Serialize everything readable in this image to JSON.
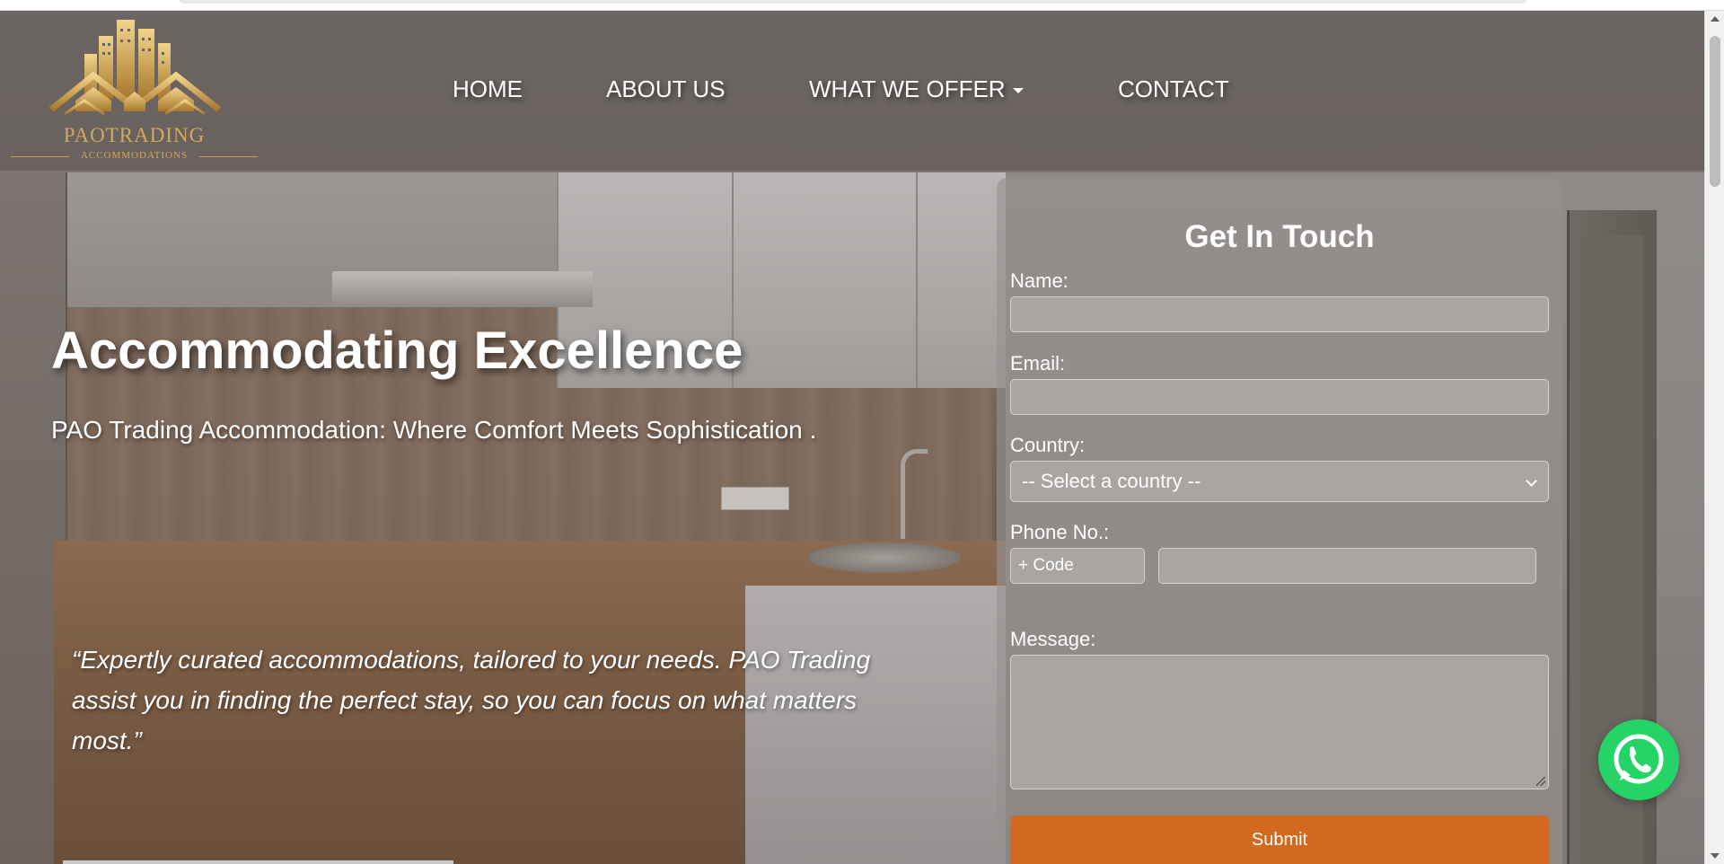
{
  "header": {
    "logo": {
      "brand": "PAOTRADING",
      "subtitle": "ACCOMMODATIONS",
      "icon": "city-houses-logo-icon",
      "gold": "#d3a85a"
    },
    "nav": [
      {
        "label": "HOME"
      },
      {
        "label": "ABOUT US"
      },
      {
        "label": "WHAT WE OFFER",
        "has_dropdown": true
      },
      {
        "label": "CONTACT"
      }
    ]
  },
  "hero": {
    "title": "Accommodating Excellence",
    "subtitle": "PAO Trading Accommodation: Where Comfort Meets Sophistication .",
    "quote": "“Expertly curated accommodations, tailored to your needs. PAO Trading assist you in finding the perfect stay, so you can focus on what matters most.”"
  },
  "contact_form": {
    "title": "Get In Touch",
    "name_label": "Name:",
    "name_value": "",
    "email_label": "Email:",
    "email_value": "",
    "country_label": "Country:",
    "country_selected": "-- Select a country --",
    "phone_label": "Phone No.:",
    "phone_code_placeholder": "+ Code",
    "phone_value": "",
    "message_label": "Message:",
    "message_value": "",
    "submit_label": "Submit",
    "submit_color": "#d2691e"
  },
  "floating": {
    "whatsapp_icon": "whatsapp-icon",
    "whatsapp_color": "#25d366"
  }
}
